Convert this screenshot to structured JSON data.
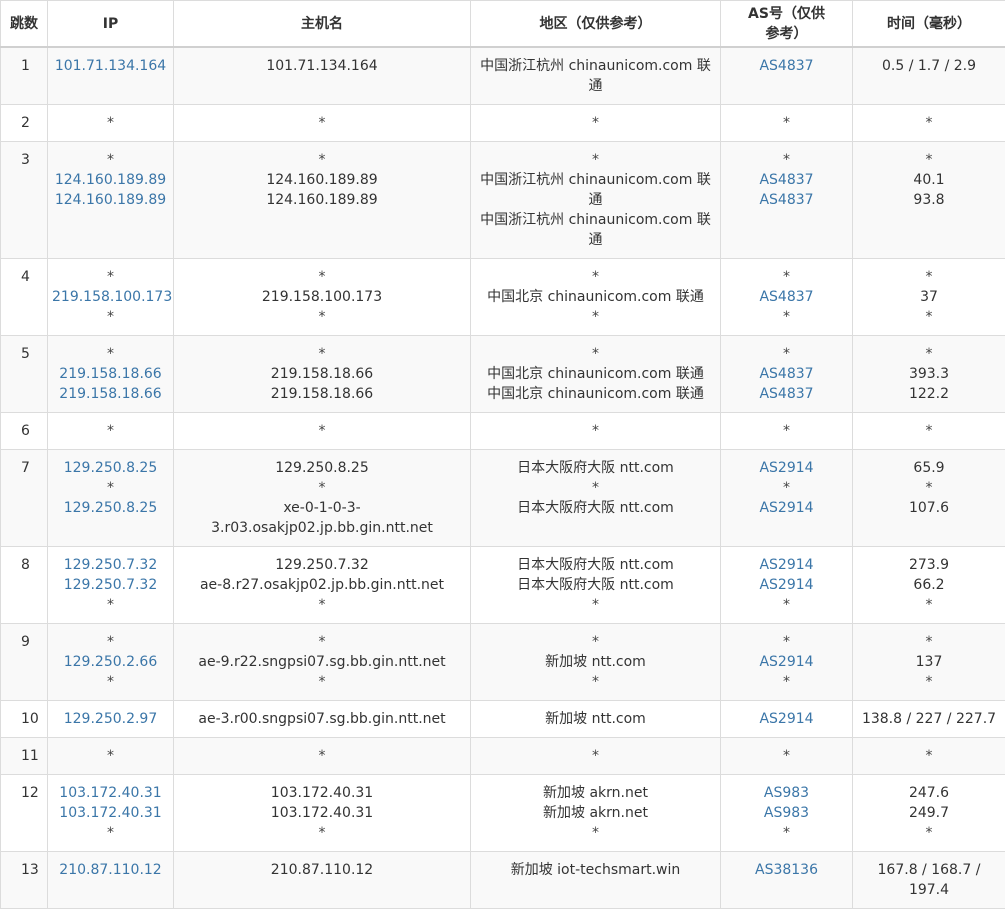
{
  "headers": {
    "hop": "跳数",
    "ip": "IP",
    "host": "主机名",
    "region": "地区（仅供参考）",
    "asn": "AS号（仅供参考）",
    "time": "时间（毫秒）"
  },
  "rows": [
    {
      "hop": "1",
      "ip": [
        "101.71.134.164"
      ],
      "host": [
        "101.71.134.164"
      ],
      "region": [
        "中国浙江杭州 chinaunicom.com 联通"
      ],
      "asn": [
        "AS4837"
      ],
      "time": [
        "0.5 / 1.7 / 2.9"
      ]
    },
    {
      "hop": "2",
      "ip": [
        "*"
      ],
      "host": [
        "*"
      ],
      "region": [
        "*"
      ],
      "asn": [
        "*"
      ],
      "time": [
        "*"
      ]
    },
    {
      "hop": "3",
      "ip": [
        "*",
        "124.160.189.89",
        "124.160.189.89"
      ],
      "host": [
        "*",
        "124.160.189.89",
        "124.160.189.89"
      ],
      "region": [
        "*",
        "中国浙江杭州 chinaunicom.com 联通",
        "中国浙江杭州 chinaunicom.com 联通"
      ],
      "asn": [
        "*",
        "AS4837",
        "AS4837"
      ],
      "time": [
        "*",
        "40.1",
        "93.8"
      ]
    },
    {
      "hop": "4",
      "ip": [
        "*",
        "219.158.100.173",
        "*"
      ],
      "host": [
        "*",
        "219.158.100.173",
        "*"
      ],
      "region": [
        "*",
        "中国北京 chinaunicom.com 联通",
        "*"
      ],
      "asn": [
        "*",
        "AS4837",
        "*"
      ],
      "time": [
        "*",
        "37",
        "*"
      ]
    },
    {
      "hop": "5",
      "ip": [
        "*",
        "219.158.18.66",
        "219.158.18.66"
      ],
      "host": [
        "*",
        "219.158.18.66",
        "219.158.18.66"
      ],
      "region": [
        "*",
        "中国北京 chinaunicom.com 联通",
        "中国北京 chinaunicom.com 联通"
      ],
      "asn": [
        "*",
        "AS4837",
        "AS4837"
      ],
      "time": [
        "*",
        "393.3",
        "122.2"
      ]
    },
    {
      "hop": "6",
      "ip": [
        "*"
      ],
      "host": [
        "*"
      ],
      "region": [
        "*"
      ],
      "asn": [
        "*"
      ],
      "time": [
        "*"
      ]
    },
    {
      "hop": "7",
      "ip": [
        "129.250.8.25",
        "*",
        "129.250.8.25"
      ],
      "host": [
        "129.250.8.25",
        "*",
        "xe-0-1-0-3-3.r03.osakjp02.jp.bb.gin.ntt.net"
      ],
      "region": [
        "日本大阪府大阪 ntt.com",
        "*",
        "日本大阪府大阪 ntt.com"
      ],
      "asn": [
        "AS2914",
        "*",
        "AS2914"
      ],
      "time": [
        "65.9",
        "*",
        "107.6"
      ]
    },
    {
      "hop": "8",
      "ip": [
        "129.250.7.32",
        "129.250.7.32",
        "*"
      ],
      "host": [
        "129.250.7.32",
        "ae-8.r27.osakjp02.jp.bb.gin.ntt.net",
        "*"
      ],
      "region": [
        "日本大阪府大阪 ntt.com",
        "日本大阪府大阪 ntt.com",
        "*"
      ],
      "asn": [
        "AS2914",
        "AS2914",
        "*"
      ],
      "time": [
        "273.9",
        "66.2",
        "*"
      ]
    },
    {
      "hop": "9",
      "ip": [
        "*",
        "129.250.2.66",
        "*"
      ],
      "host": [
        "*",
        "ae-9.r22.sngpsi07.sg.bb.gin.ntt.net",
        "*"
      ],
      "region": [
        "*",
        "新加坡 ntt.com",
        "*"
      ],
      "asn": [
        "*",
        "AS2914",
        "*"
      ],
      "time": [
        "*",
        "137",
        "*"
      ]
    },
    {
      "hop": "10",
      "ip": [
        "129.250.2.97"
      ],
      "host": [
        "ae-3.r00.sngpsi07.sg.bb.gin.ntt.net"
      ],
      "region": [
        "新加坡 ntt.com"
      ],
      "asn": [
        "AS2914"
      ],
      "time": [
        "138.8 / 227 / 227.7"
      ]
    },
    {
      "hop": "11",
      "ip": [
        "*"
      ],
      "host": [
        "*"
      ],
      "region": [
        "*"
      ],
      "asn": [
        "*"
      ],
      "time": [
        "*"
      ]
    },
    {
      "hop": "12",
      "ip": [
        "103.172.40.31",
        "103.172.40.31",
        "*"
      ],
      "host": [
        "103.172.40.31",
        "103.172.40.31",
        "*"
      ],
      "region": [
        "新加坡 akrn.net",
        "新加坡 akrn.net",
        "*"
      ],
      "asn": [
        "AS983",
        "AS983",
        "*"
      ],
      "time": [
        "247.6",
        "249.7",
        "*"
      ]
    },
    {
      "hop": "13",
      "ip": [
        "210.87.110.12"
      ],
      "host": [
        "210.87.110.12"
      ],
      "region": [
        "新加坡 iot-techsmart.win"
      ],
      "asn": [
        "AS38136"
      ],
      "time": [
        "167.8 / 168.7 / 197.4"
      ]
    }
  ],
  "colors": {
    "link": "#3b76a8",
    "text": "#333333",
    "row_alt": "#f9f9f9",
    "border": "#dcdcdc"
  }
}
